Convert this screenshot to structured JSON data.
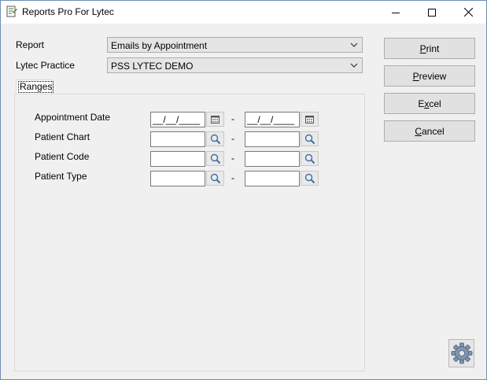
{
  "window": {
    "title": "Reports Pro For Lytec"
  },
  "form": {
    "report_label": "Report",
    "report_value": "Emails by Appointment",
    "practice_label": "Lytec Practice",
    "practice_value": "PSS LYTEC DEMO"
  },
  "tabs": {
    "ranges": "Ranges"
  },
  "ranges": {
    "dash": "-",
    "rows": [
      {
        "label": "Appointment Date",
        "from": "__/__/____",
        "to": "__/__/____",
        "picker": "calendar-icon"
      },
      {
        "label": "Patient Chart",
        "from": "",
        "to": "",
        "picker": "magnifier-icon"
      },
      {
        "label": "Patient Code",
        "from": "",
        "to": "",
        "picker": "magnifier-icon"
      },
      {
        "label": "Patient Type",
        "from": "",
        "to": "",
        "picker": "magnifier-icon"
      }
    ]
  },
  "buttons": {
    "print": {
      "pre": "",
      "key": "P",
      "post": "rint"
    },
    "preview": {
      "pre": "",
      "key": "P",
      "post": "review"
    },
    "excel": {
      "pre": "E",
      "key": "x",
      "post": "cel"
    },
    "cancel": {
      "pre": "",
      "key": "C",
      "post": "ancel"
    }
  },
  "colors": {
    "window_border": "#6f8fb3",
    "body_bg": "#f0f0f0",
    "button_bg": "#e1e1e1"
  }
}
